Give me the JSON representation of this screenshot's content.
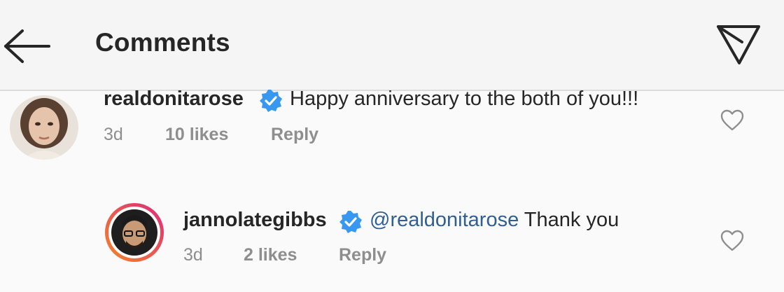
{
  "header": {
    "title": "Comments",
    "back_icon": "back-arrow-icon",
    "send_icon": "direct-send-icon"
  },
  "comments": [
    {
      "username": "realdonitarose",
      "verified": true,
      "text": "Happy anniversary to the both of you!!!",
      "time": "3d",
      "likes": "10 likes",
      "reply_label": "Reply"
    },
    {
      "username": "jannolategibbs",
      "verified": true,
      "mention": "@realdonitarose",
      "text": "Thank you",
      "time": "3d",
      "likes": "2 likes",
      "reply_label": "Reply"
    }
  ],
  "colors": {
    "verified_badge": "#3897f0",
    "mention": "#2f5f93",
    "meta_text": "#8e8e8e",
    "story_ring_start": "#f58529",
    "story_ring_end": "#dd2a7b"
  }
}
